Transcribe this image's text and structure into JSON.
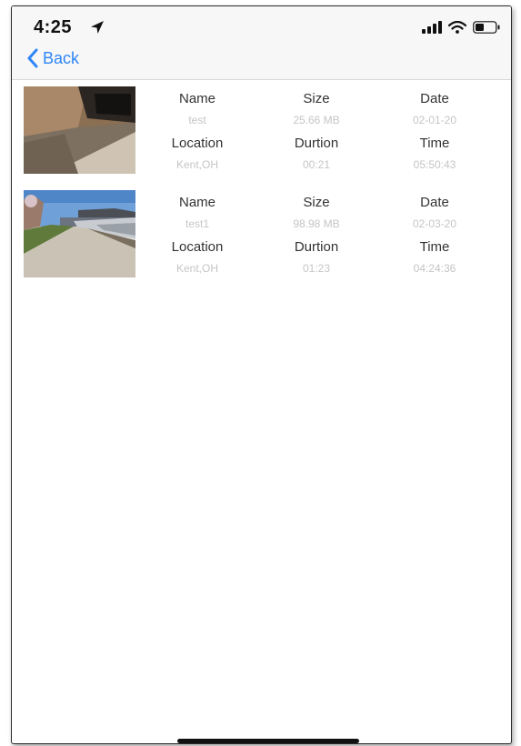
{
  "status_bar": {
    "time": "4:25",
    "location_icon": "location-arrow-icon",
    "signal_icon": "cellular-signal-icon",
    "wifi_icon": "wifi-icon",
    "battery_icon": "battery-icon"
  },
  "nav": {
    "back_label": "Back",
    "back_icon": "chevron-left-icon"
  },
  "colors": {
    "accent": "#2f86f6",
    "header_text": "#333333",
    "value_text": "#c5c5c5"
  },
  "labels": {
    "name": "Name",
    "size": "Size",
    "date": "Date",
    "location": "Location",
    "duration": "Durtion",
    "time": "Time"
  },
  "videos": [
    {
      "name": "test",
      "size": "25.66 MB",
      "date": "02-01-20",
      "location": "Kent,OH",
      "duration": "00:21",
      "time": "05:50:43"
    },
    {
      "name": "test1",
      "size": "98.98 MB",
      "date": "02-03-20",
      "location": "Kent,OH",
      "duration": "01:23",
      "time": "04:24:36"
    }
  ]
}
